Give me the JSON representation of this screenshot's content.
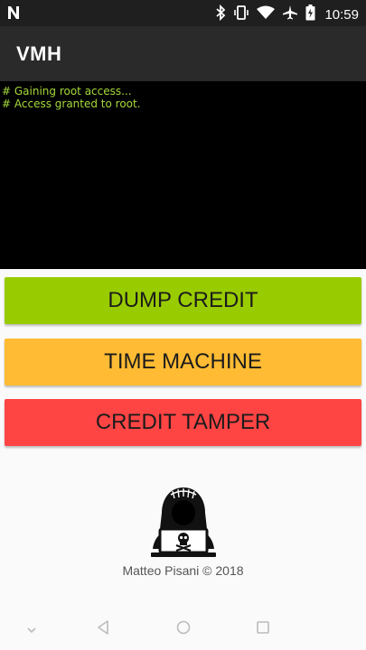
{
  "status_bar": {
    "time": "10:59",
    "icons": [
      "notification-n-icon",
      "bluetooth-icon",
      "vibrate-icon",
      "wifi-icon",
      "airplane-icon",
      "battery-icon"
    ]
  },
  "app_bar": {
    "title": "VMH"
  },
  "console": {
    "lines": [
      "# Gaining root access...",
      "# Access granted to root."
    ],
    "text_color": "#a5d83a",
    "background": "#000000"
  },
  "buttons": {
    "dump_credit": {
      "label": "DUMP CREDIT",
      "color": "#99cc00"
    },
    "time_machine": {
      "label": "TIME MACHINE",
      "color": "#ffbb33"
    },
    "credit_tamper": {
      "label": "CREDIT TAMPER",
      "color": "#ff4444"
    }
  },
  "footer": {
    "credit": "Matteo Pisani © 2018",
    "logo": "hacker-icon"
  },
  "nav_bar": {
    "icons": [
      "keyboard-hide-icon",
      "back-icon",
      "home-icon",
      "recents-icon"
    ]
  }
}
